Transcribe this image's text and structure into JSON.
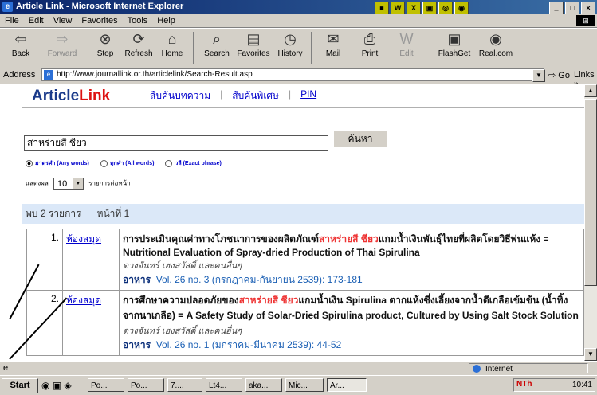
{
  "window": {
    "title": "Article Link - Microsoft Internet Explorer",
    "controls": [
      "_",
      "□",
      "×"
    ]
  },
  "menu": [
    "File",
    "Edit",
    "View",
    "Favorites",
    "Tools",
    "Help"
  ],
  "toolbar": {
    "back": "Back",
    "forward": "Forward",
    "stop": "Stop",
    "refresh": "Refresh",
    "home": "Home",
    "search": "Search",
    "favorites": "Favorites",
    "history": "History",
    "mail": "Mail",
    "print": "Print",
    "edit": "Edit",
    "flashget": "FlashGet",
    "realcom": "Real.com"
  },
  "address": {
    "label": "Address",
    "url": "http://www.journallink.or.th/articlelink/Search-Result.asp",
    "go": "Go",
    "links": "Links »"
  },
  "page": {
    "logo_article": "Article",
    "logo_link": "Link",
    "nav": [
      "สืบค้นบทความ",
      "สืบค้นพิเศษ",
      "PIN"
    ],
    "search_value": "สาหร่ายสี ชียว",
    "search_button": "ค้นหา",
    "radios": [
      {
        "label": "มาตรคำ (Any words)",
        "checked": true
      },
      {
        "label": "ทุกคำ (All words)",
        "checked": false
      },
      {
        "label": "วลี (Exact phrase)",
        "checked": false
      }
    ],
    "perpage_prefix": "แสดงผล",
    "perpage_value": "10",
    "perpage_suffix": "รายการต่อหน้า",
    "result_count": "พบ 2 รายการ",
    "page_number": "หน้าที่ 1"
  },
  "results": [
    {
      "num": "1.",
      "library": "ห้องสมุด",
      "title_pre": "การประเมินคุณค่าทางโภชนาการของผลิตภัณฑ์",
      "title_hl": "สาหร่ายสี ชียว",
      "title_post": "แกมน้ำเงินพันธุ์ไทยที่ผลิตโดยวิธีพ่นแห้ง = Nutritional Evaluation of Spray-dried Production of Thai Spirulina",
      "authors": "ดวงจันทร์ เฮงสวัสดิ์ และคนอื่นๆ",
      "journal": "อาหาร",
      "citation": "Vol. 26 no. 3 (กรกฎาคม-กันยายน 2539): 173-181"
    },
    {
      "num": "2.",
      "library": "ห้องสมุด",
      "title_pre": "การศึกษาความปลอดภัยของ",
      "title_hl": "สาหร่ายสี ชียว",
      "title_post": "แกมน้ำเงิน Spirulina ตากแห้งซึ่งเลี้ยงจากน้ำดีเกลือเข้มข้น (น้ำทิ้งจากนาเกลือ) = A Safety Study of Solar-Dried Spirulina product, Cultured by Using Salt Stock Solution",
      "authors": "ดวงจันทร์ เฮงสวัสดิ์ และคนอื่นๆ",
      "journal": "อาหาร",
      "citation": "Vol. 26 no. 1 (มกราคม-มีนาคม 2539): 44-52"
    }
  ],
  "status": {
    "zone": "Internet"
  },
  "taskbar": {
    "start": "Start",
    "tasks": [
      "Po...",
      "Po...",
      "7....",
      "Lt4...",
      "aka...",
      "Mic...",
      "Ar..."
    ],
    "clock": "10:41",
    "tray_icons": "NTh"
  }
}
